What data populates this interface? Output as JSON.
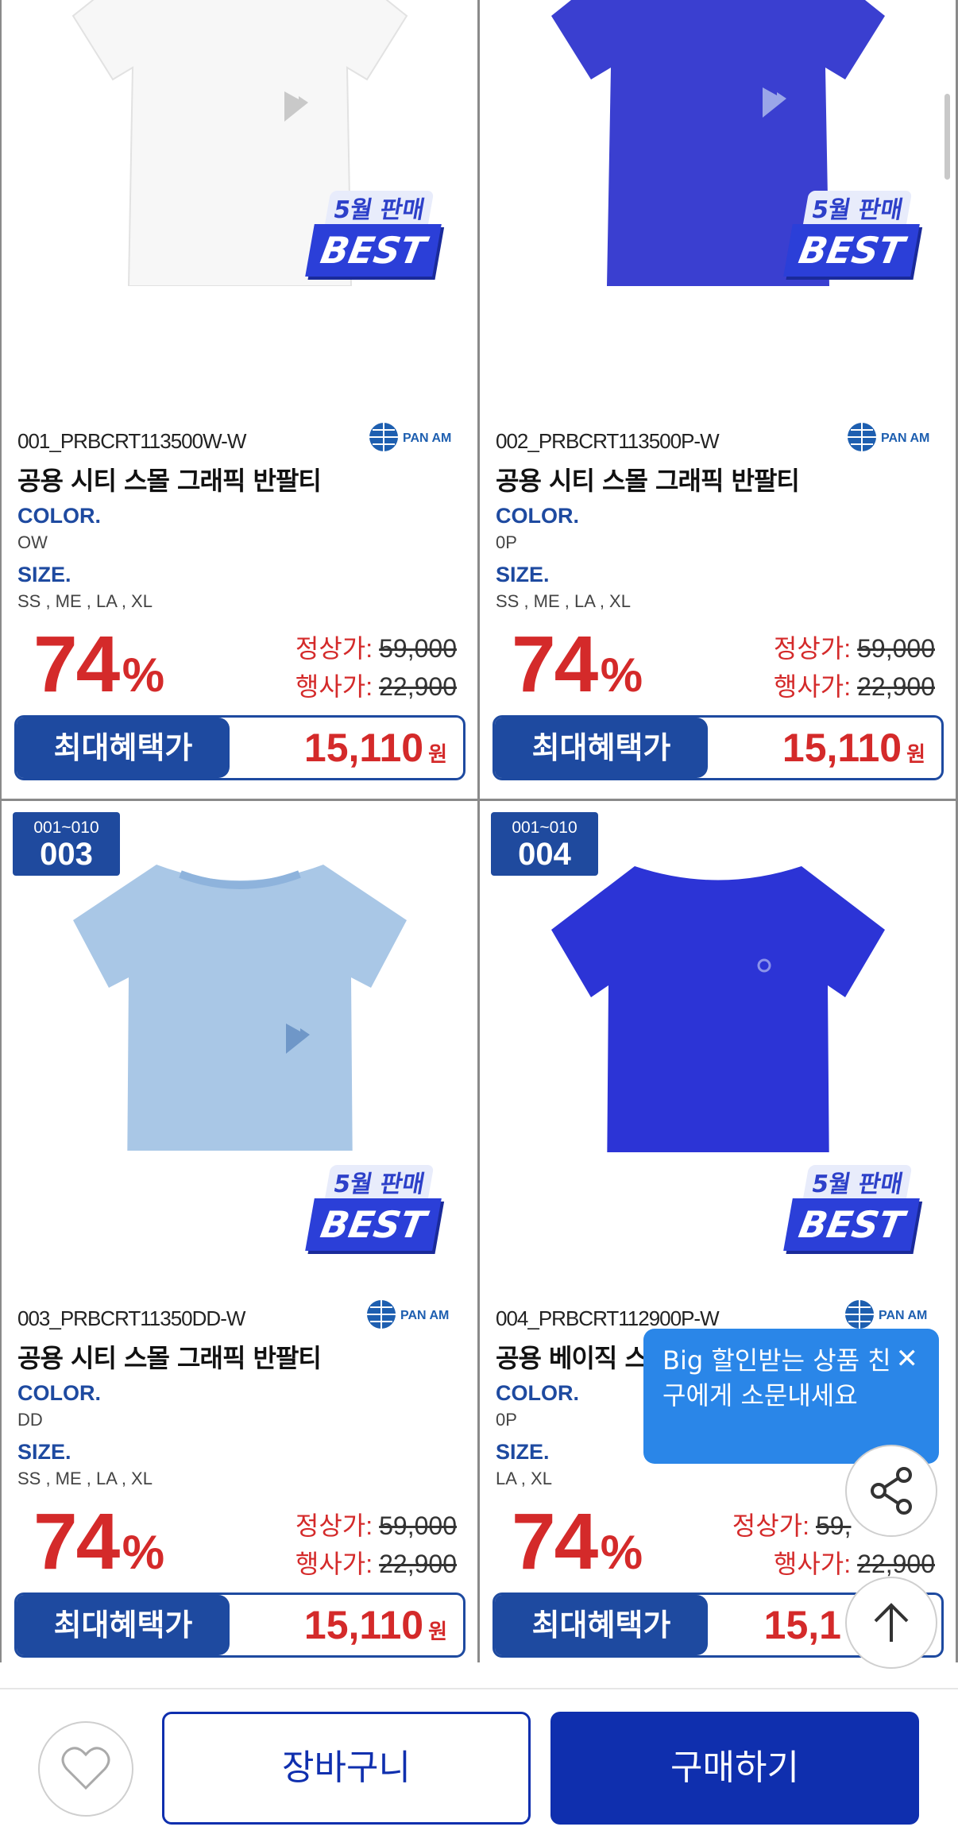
{
  "products": [
    {
      "range": "",
      "index": "",
      "code": "001_PRBCRT113500W-W",
      "name": "공용 시티 스몰 그래픽 반팔티",
      "color_label": "COLOR.",
      "color": "OW",
      "size_label": "SIZE.",
      "sizes": "SS , ME , LA , XL",
      "discount": "74",
      "percent": "%",
      "regular_label": "정상가:",
      "regular_price": "59,000",
      "event_label": "행사가:",
      "event_price": "22,900",
      "benefit_label": "최대혜택가",
      "benefit_price": "15,110",
      "currency": "원",
      "best_month": "5월 판매",
      "best_text": "BEST",
      "brand": "PAN AM",
      "shirt_color": "#f7f7f7"
    },
    {
      "range": "",
      "index": "",
      "code": "002_PRBCRT113500P-W",
      "name": "공용 시티 스몰 그래픽 반팔티",
      "color_label": "COLOR.",
      "color": "0P",
      "size_label": "SIZE.",
      "sizes": "SS , ME , LA , XL",
      "discount": "74",
      "percent": "%",
      "regular_label": "정상가:",
      "regular_price": "59,000",
      "event_label": "행사가:",
      "event_price": "22,900",
      "benefit_label": "최대혜택가",
      "benefit_price": "15,110",
      "currency": "원",
      "best_month": "5월 판매",
      "best_text": "BEST",
      "brand": "PAN AM",
      "shirt_color": "#3a3fd0"
    },
    {
      "range": "001~010",
      "index": "003",
      "code": "003_PRBCRT11350DD-W",
      "name": "공용 시티 스몰 그래픽 반팔티",
      "color_label": "COLOR.",
      "color": "DD",
      "size_label": "SIZE.",
      "sizes": "SS , ME , LA , XL",
      "discount": "74",
      "percent": "%",
      "regular_label": "정상가:",
      "regular_price": "59,000",
      "event_label": "행사가:",
      "event_price": "22,900",
      "benefit_label": "최대혜택가",
      "benefit_price": "15,110",
      "currency": "원",
      "best_month": "5월 판매",
      "best_text": "BEST",
      "brand": "PAN AM",
      "shirt_color": "#a9c7e6"
    },
    {
      "range": "001~010",
      "index": "004",
      "code": "004_PRBCRT112900P-W",
      "name": "공용 베이직 스",
      "color_label": "COLOR.",
      "color": "0P",
      "size_label": "SIZE.",
      "sizes": "LA , XL",
      "discount": "74",
      "percent": "%",
      "regular_label": "정상가:",
      "regular_price": "59,",
      "event_label": "행사가:",
      "event_price": "22,900",
      "benefit_label": "최대혜택가",
      "benefit_price": "15,1",
      "currency": "",
      "best_month": "5월 판매",
      "best_text": "BEST",
      "brand": "PAN AM",
      "shirt_color": "#2c34d6"
    }
  ],
  "tooltip": {
    "text": "Big 할인받는 상품 친구에게 소문내세요",
    "close": "✕"
  },
  "footer": {
    "cart": "장바구니",
    "buy": "구매하기"
  },
  "icons": {
    "share": "share-icon",
    "top": "arrow-up-icon",
    "heart": "heart-icon"
  },
  "colors": {
    "brand_blue": "#1e4aa0",
    "sale_red": "#d42a2a",
    "buy_blue": "#0f2fae"
  }
}
